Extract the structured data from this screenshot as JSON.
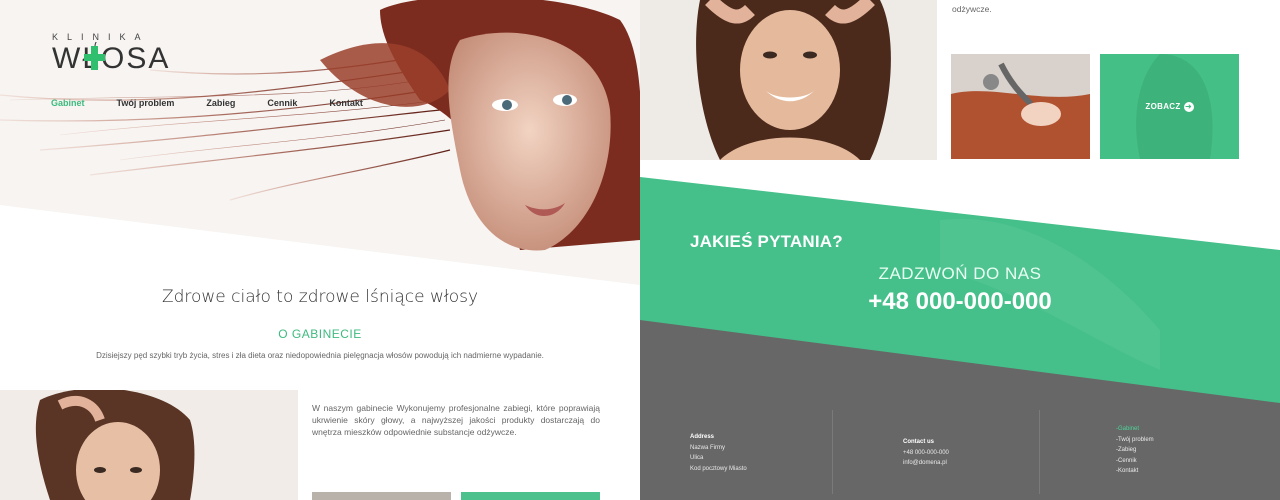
{
  "logo": {
    "top": "KLINIKA",
    "main": "WŁOSA"
  },
  "nav": {
    "items": [
      {
        "label": "Gabinet",
        "active": true
      },
      {
        "label": "Twój problem",
        "active": false
      },
      {
        "label": "Zabieg",
        "active": false
      },
      {
        "label": "Cennik",
        "active": false
      },
      {
        "label": "Kontakt",
        "active": false
      }
    ]
  },
  "hero": {
    "tagline": "Zdrowe ciało to zdrowe lśniące włosy"
  },
  "about": {
    "title": "O GABINECIE",
    "intro": "Dzisiejszy pęd szybki tryb życia, stres i zła dieta oraz niedopowiednia pielęgnacja włosów  powodują  ich nadmierne  wypadanie.",
    "body": "W naszym gabinecie  Wykonujemy profesjonalne zabiegi, które poprawiają ukrwienie skóry głowy, a najwyższej jakości produkty dostarczają do wnętrza mieszków odpowiednie substancje odżywcze.",
    "body_tail": "odżywcze."
  },
  "gallery": {
    "cta_label": "ZOBACZ",
    "cta_icon": "arrow-right-circle-icon"
  },
  "contact_band": {
    "question": "JAKIEŚ PYTANIA?",
    "call_label": "ZADZWOŃ DO NAS",
    "phone": "+48 000-000-000"
  },
  "footer": {
    "address": {
      "heading": "Address",
      "lines": [
        "Nazwa Firmy",
        "Ulica",
        "Kod pocztowy Miasto"
      ]
    },
    "contact": {
      "heading": "Contact us",
      "lines": [
        "+48 000-000-000",
        "info@domena.pl"
      ]
    },
    "links": [
      "-Gabinet",
      "-Twój problem",
      "-Zabieg",
      "-Cennik",
      "-Kontakt"
    ]
  },
  "colors": {
    "accent": "#3dbb7e",
    "band_green": "#45c08a",
    "footer_gray": "#676767"
  }
}
